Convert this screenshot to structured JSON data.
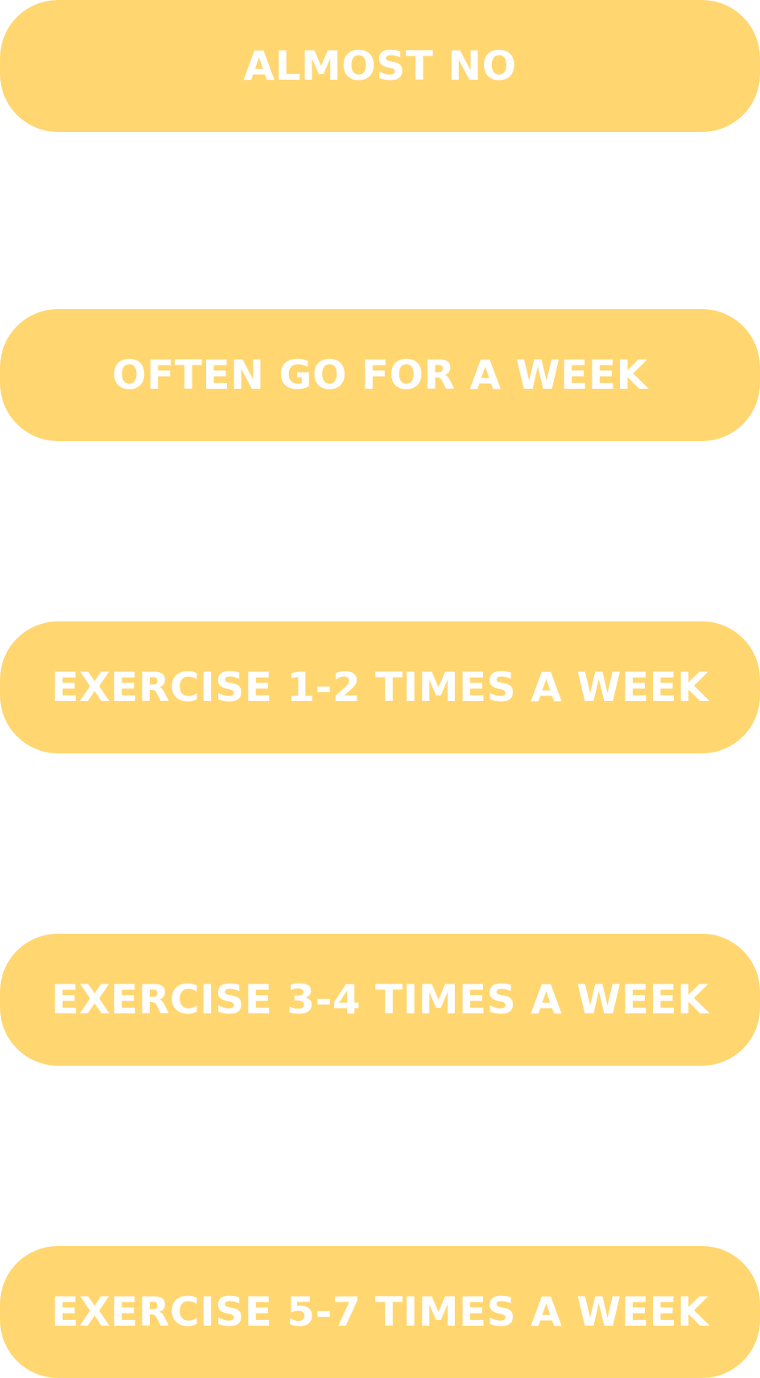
{
  "theme": {
    "button_color": "#FFD670",
    "text_color": "#FFFFFF",
    "background": "#FFFFFF"
  },
  "options": [
    {
      "label": "ALMOST NO"
    },
    {
      "label": "OFTEN GO FOR A WEEK"
    },
    {
      "label": "EXERCISE 1-2 TIMES A WEEK"
    },
    {
      "label": "EXERCISE 3-4 TIMES A WEEK"
    },
    {
      "label": "EXERCISE 5-7 TIMES A WEEK"
    }
  ]
}
